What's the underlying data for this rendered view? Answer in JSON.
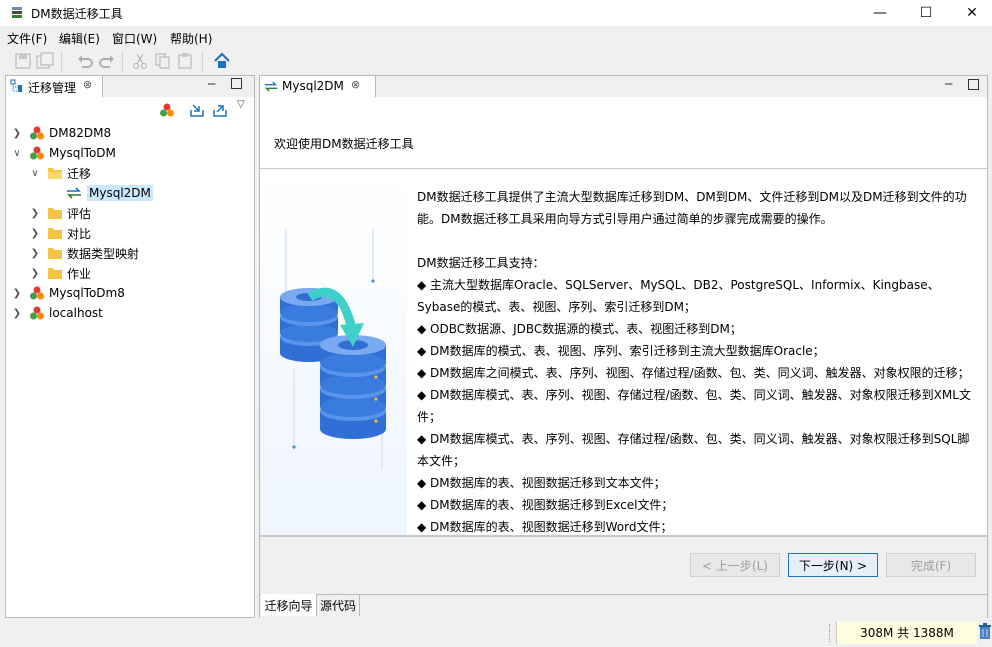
{
  "window": {
    "title": "DM数据迁移工具"
  },
  "menu": [
    "文件(F)",
    "编辑(E)",
    "窗口(W)",
    "帮助(H)"
  ],
  "left_panel": {
    "title": "迁移管理",
    "tree": [
      {
        "label": "DM82DM8",
        "expanded": false,
        "icon": "project-icon",
        "level": 0
      },
      {
        "label": "MysqlToDM",
        "expanded": true,
        "icon": "project-icon",
        "level": 0
      },
      {
        "label": "迁移",
        "expanded": true,
        "icon": "folder-open-icon",
        "level": 1
      },
      {
        "label": "Mysql2DM",
        "icon": "migration-icon",
        "level": 2,
        "selected": true
      },
      {
        "label": "评估",
        "expanded": false,
        "icon": "folder-icon",
        "level": 1
      },
      {
        "label": "对比",
        "expanded": false,
        "icon": "folder-icon",
        "level": 1
      },
      {
        "label": "数据类型映射",
        "expanded": false,
        "icon": "folder-icon",
        "level": 1
      },
      {
        "label": "作业",
        "expanded": false,
        "icon": "folder-icon",
        "level": 1
      },
      {
        "label": "MysqlToDm8",
        "expanded": false,
        "icon": "project-icon",
        "level": 0
      },
      {
        "label": "localhost",
        "expanded": false,
        "icon": "project-icon",
        "level": 0
      }
    ]
  },
  "editor": {
    "tab_title": "Mysql2DM",
    "welcome": "欢迎使用DM数据迁移工具",
    "intro": "DM数据迁移工具提供了主流大型数据库迁移到DM、DM到DM、文件迁移到DM以及DM迁移到文件的功能。DM数据迁移工具采用向导方式引导用户通过简单的步骤完成需要的操作。",
    "support_title": "DM数据迁移工具支持：",
    "features": [
      "◆ 主流大型数据库Oracle、SQLServer、MySQL、DB2、PostgreSQL、Informix、Kingbase、Sybase的模式、表、视图、序列、索引迁移到DM；",
      "◆ ODBC数据源、JDBC数据源的模式、表、视图迁移到DM；",
      "◆ DM数据库的模式、表、视图、序列、索引迁移到主流大型数据库Oracle；",
      "◆ DM数据库之间模式、表、序列、视图、存储过程/函数、包、类、同义词、触发器、对象权限的迁移；",
      "◆ DM数据库模式、表、序列、视图、存储过程/函数、包、类、同义词、触发器、对象权限迁移到XML文件；",
      "◆ DM数据库模式、表、序列、视图、存储过程/函数、包、类、同义词、触发器、对象权限迁移到SQL脚本文件；",
      "◆ DM数据库的表、视图数据迁移到文本文件；",
      "◆ DM数据库的表、视图数据迁移到Excel文件；",
      "◆ DM数据库的表、视图数据迁移到Word文件；"
    ],
    "buttons": {
      "prev": "< 上一步(L)",
      "next": "下一步(N) >",
      "finish": "完成(F)"
    },
    "bottom_tabs": [
      "迁移向导",
      "源代码"
    ]
  },
  "status": {
    "memory": "308M 共 1388M"
  },
  "colors": {
    "selected_bg": "#cce8ff",
    "accent": "#1e73be"
  }
}
